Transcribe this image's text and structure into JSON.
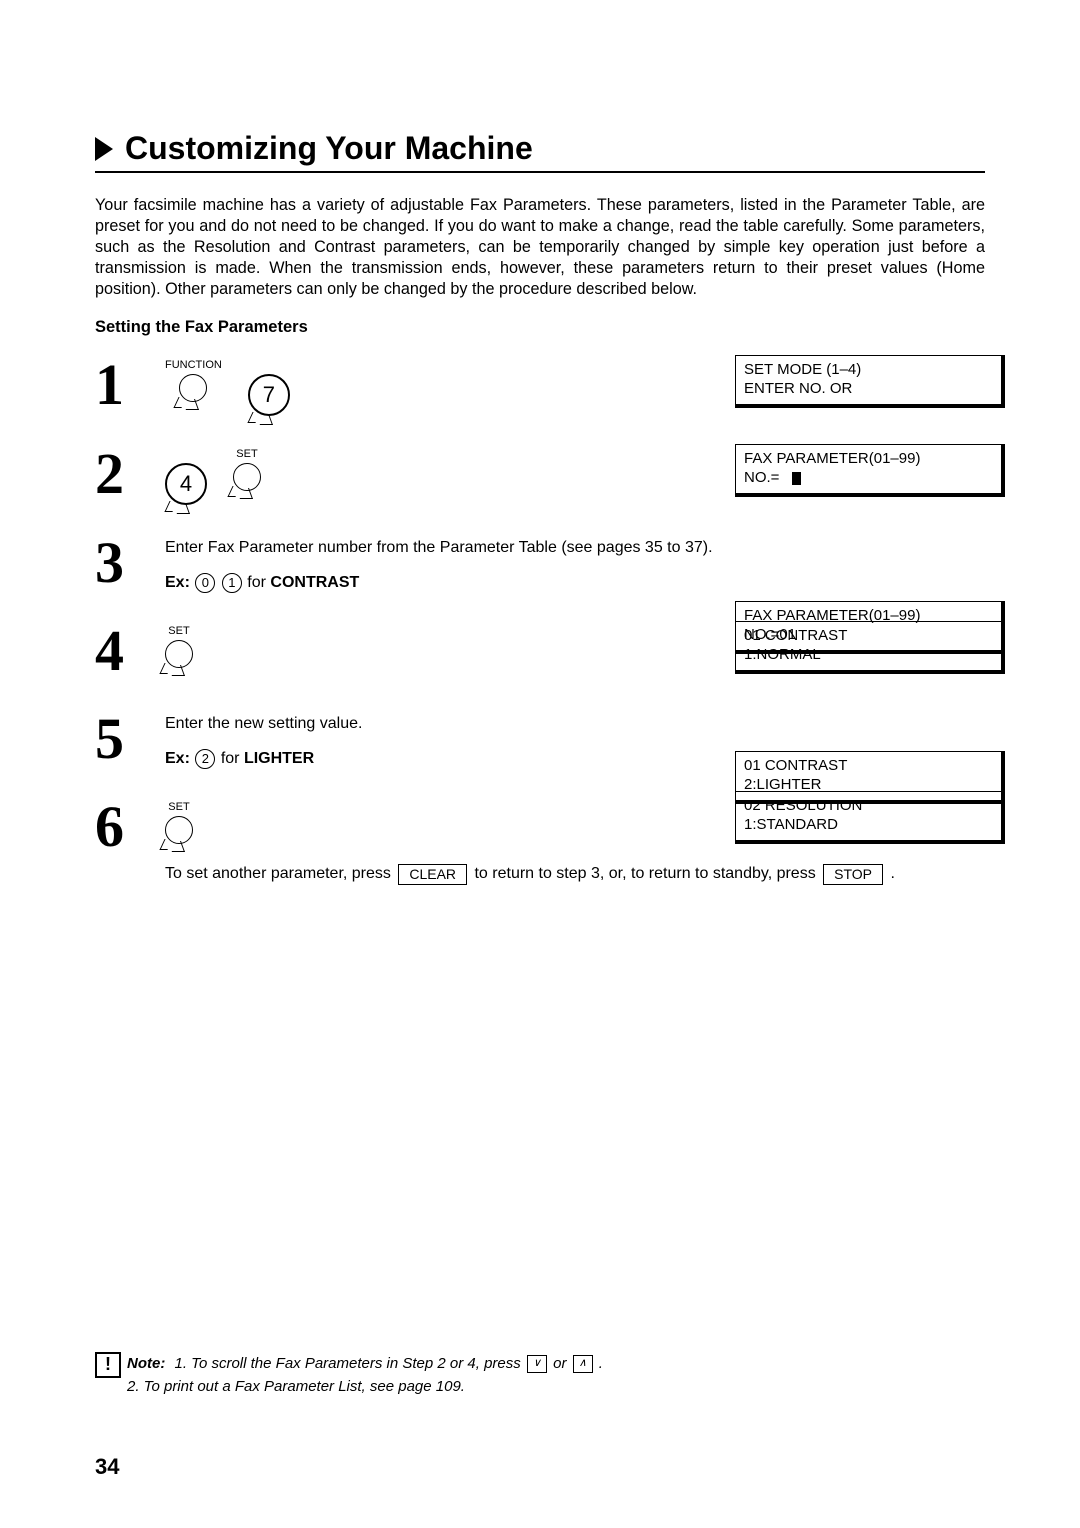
{
  "title": "Customizing Your Machine",
  "intro": "Your facsimile machine has a variety of adjustable Fax Parameters.  These parameters, listed in the Parameter Table, are preset for you and do not need to be changed.  If you do want to make a change, read the table carefully.  Some parameters, such as the Resolution and Contrast parameters, can be temporarily changed by simple key operation just before a transmission is made.  When the transmission ends, however, these parameters return to their preset values (Home position).  Other parameters can only be changed by the procedure described below.",
  "subhead": "Setting the Fax Parameters",
  "steps": {
    "s1": {
      "num": "1",
      "fn_label": "FUNCTION",
      "big_key": "7",
      "lcd_l1": "SET MODE       (1–4)",
      "lcd_l2": "ENTER NO. OR"
    },
    "s2": {
      "num": "2",
      "big_key": "4",
      "set_label": "SET",
      "lcd_l1": "FAX PARAMETER(01–99)",
      "lcd_l2_prefix": "        NO.="
    },
    "s3": {
      "num": "3",
      "text": "Enter Fax Parameter number from the Parameter Table (see pages 35 to 37).",
      "ex_prefix": "Ex:",
      "ex_k1": "0",
      "ex_k2": "1",
      "ex_for": " for ",
      "ex_word": "CONTRAST",
      "lcd_l1": "FAX PARAMETER(01–99)",
      "lcd_l2": "  NO.=01"
    },
    "s4": {
      "num": "4",
      "set_label": "SET",
      "lcd_l1": "01 CONTRAST",
      "lcd_l2": " 1:NORMAL"
    },
    "s5": {
      "num": "5",
      "text": "Enter the new setting value.",
      "ex_prefix": "Ex:",
      "ex_k1": "2",
      "ex_for": " for ",
      "ex_word": "LIGHTER",
      "lcd_l1": "01 CONTRAST",
      "lcd_l2": " 2:LIGHTER"
    },
    "s6": {
      "num": "6",
      "set_label": "SET",
      "lcd_l1": "02 RESOLUTION",
      "lcd_l2": " 1:STANDARD",
      "after1a": "To set another parameter, press ",
      "clear": "CLEAR",
      "after1b": " to return to step 3, or, to return to standby, press ",
      "stop": "STOP",
      "after1c": " ."
    }
  },
  "note": {
    "label": "Note:",
    "l1a": "1. To scroll the Fax Parameters in Step 2 or 4, press ",
    "l1b": " or ",
    "l1c": " .",
    "l2": "2. To print out a Fax Parameter List, see page 109."
  },
  "pagenum": "34"
}
